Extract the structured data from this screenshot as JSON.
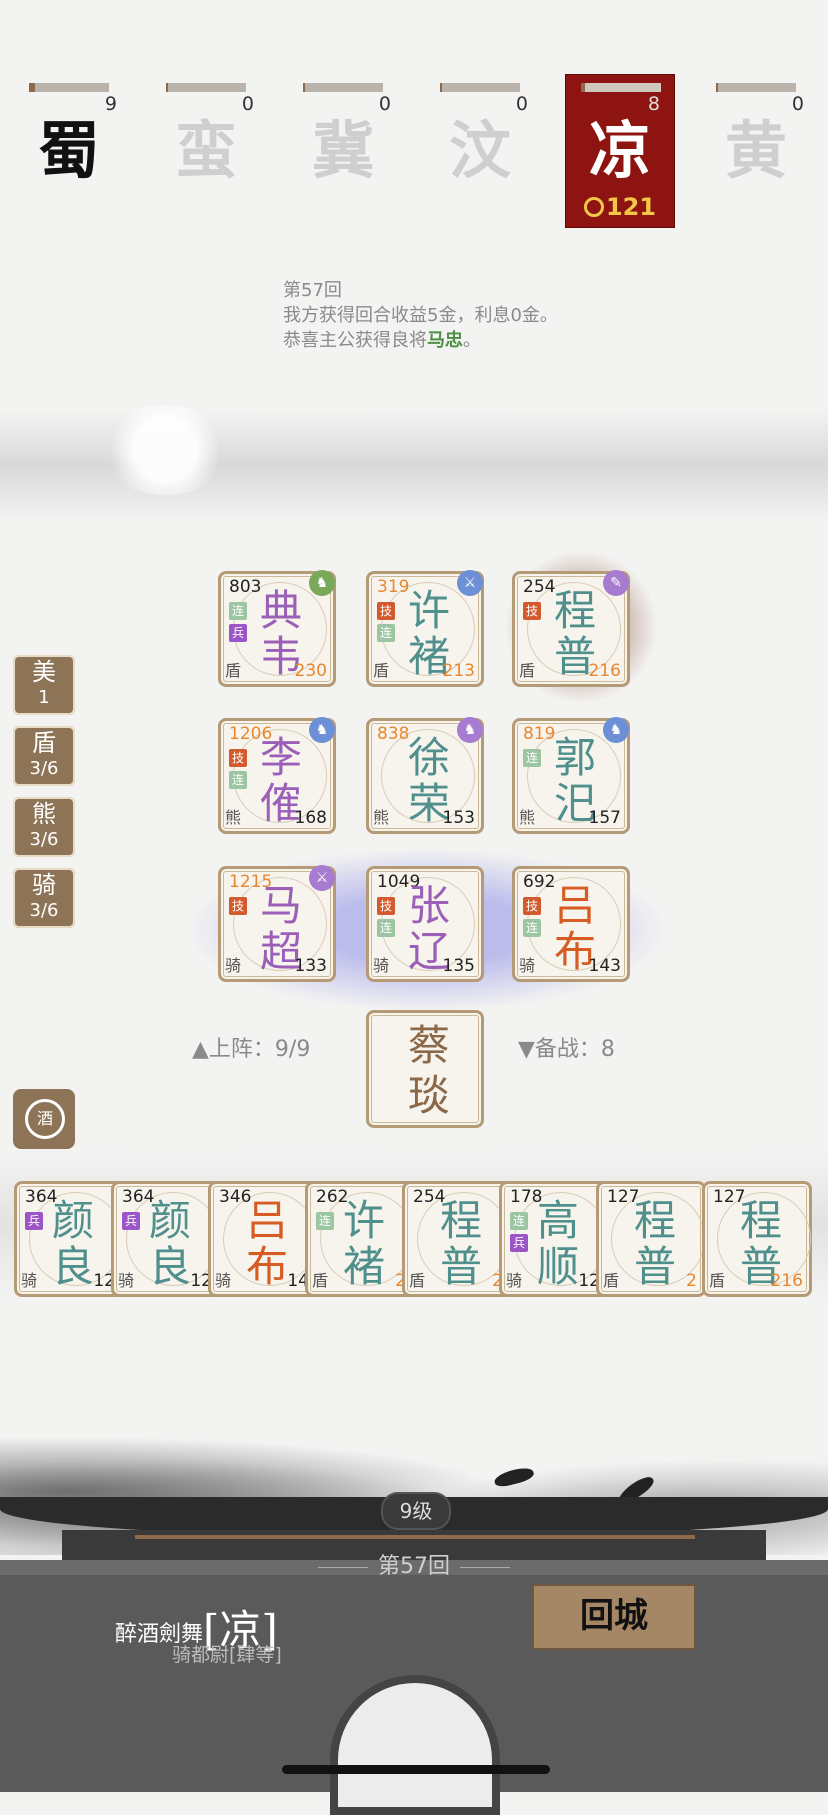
{
  "factions": [
    {
      "char": "蜀",
      "count": "9",
      "progress": 0.08,
      "style": "dark"
    },
    {
      "char": "蛮",
      "count": "0",
      "progress": 0.02,
      "style": "light"
    },
    {
      "char": "冀",
      "count": "0",
      "progress": 0.02,
      "style": "light"
    },
    {
      "char": "汶",
      "count": "0",
      "progress": 0.02,
      "style": "light"
    },
    {
      "char": "凉",
      "count": "8",
      "progress": 0.05,
      "style": "active",
      "gold": "121"
    },
    {
      "char": "黄",
      "count": "0",
      "progress": 0.02,
      "style": "light"
    }
  ],
  "log": {
    "line1": "第57回",
    "line2": "我方获得回合收益5金，利息0金。",
    "line3_prefix": "恭喜主公获得良将",
    "line3_name": "马忠",
    "line3_suffix": "。"
  },
  "side_tags": [
    {
      "title": "美",
      "value": "1"
    },
    {
      "title": "盾",
      "value": "3/6"
    },
    {
      "title": "熊",
      "value": "3/6"
    },
    {
      "title": "骑",
      "value": "3/6"
    }
  ],
  "board": [
    {
      "hp": "803",
      "name1": "典",
      "name2": "韦",
      "type": "盾",
      "stat": "230",
      "badges": [
        "连",
        "兵"
      ]
    },
    {
      "hp": "319",
      "name1": "许",
      "name2": "褚",
      "type": "盾",
      "stat": "213",
      "badges": [
        "技",
        "连"
      ]
    },
    {
      "hp": "254",
      "name1": "程",
      "name2": "普",
      "type": "盾",
      "stat": "216",
      "badges": [
        "技"
      ]
    },
    {
      "hp": "1206",
      "name1": "李",
      "name2": "傕",
      "type": "熊",
      "stat": "168",
      "badges": [
        "技",
        "连"
      ]
    },
    {
      "hp": "838",
      "name1": "徐",
      "name2": "荣",
      "type": "熊",
      "stat": "153",
      "badges": []
    },
    {
      "hp": "819",
      "name1": "郭",
      "name2": "汜",
      "type": "熊",
      "stat": "157",
      "badges": [
        "连"
      ]
    },
    {
      "hp": "1215",
      "name1": "马",
      "name2": "超",
      "type": "骑",
      "stat": "133",
      "badges": [
        "技"
      ]
    },
    {
      "hp": "1049",
      "name1": "张",
      "name2": "辽",
      "type": "骑",
      "stat": "135",
      "badges": [
        "技",
        "连"
      ]
    },
    {
      "hp": "692",
      "name1": "吕",
      "name2": "布",
      "type": "骑",
      "stat": "143",
      "badges": [
        "技",
        "连"
      ]
    }
  ],
  "deploy": {
    "left": "▲上阵：9/9",
    "right": "▼备战：8"
  },
  "featured": {
    "name1": "蔡",
    "name2": "琰"
  },
  "wine_icon": "酒",
  "bench": [
    {
      "hp": "364",
      "name1": "颜",
      "name2": "良",
      "type": "骑",
      "stat": "12",
      "badges": [
        "兵"
      ]
    },
    {
      "hp": "364",
      "name1": "颜",
      "name2": "良",
      "type": "骑",
      "stat": "12",
      "badges": [
        "兵"
      ]
    },
    {
      "hp": "346",
      "name1": "吕",
      "name2": "布",
      "type": "骑",
      "stat": "14",
      "badges": []
    },
    {
      "hp": "262",
      "name1": "许",
      "name2": "褚",
      "type": "盾",
      "stat": "2",
      "badges": [
        "连"
      ]
    },
    {
      "hp": "254",
      "name1": "程",
      "name2": "普",
      "type": "盾",
      "stat": "2",
      "badges": []
    },
    {
      "hp": "178",
      "name1": "高",
      "name2": "顺",
      "type": "骑",
      "stat": "12",
      "badges": [
        "连",
        "兵"
      ]
    },
    {
      "hp": "127",
      "name1": "程",
      "name2": "普",
      "type": "盾",
      "stat": "2",
      "badges": []
    },
    {
      "hp": "127",
      "name1": "程",
      "name2": "普",
      "type": "盾",
      "stat": "216",
      "badges": []
    }
  ],
  "level": "9级",
  "round": "第57回",
  "player": {
    "name": "醉酒劍舞",
    "faction": "[凉]",
    "rank": "骑都尉[肆等]"
  },
  "back_button": "回城",
  "colors": {
    "faction_active": "#8e1411",
    "card_border": "#b59a76",
    "purple_name": "#9b5fb8",
    "teal_name": "#4f8f8c",
    "orange_name": "#d65c24",
    "gold": "#f3c64a"
  }
}
